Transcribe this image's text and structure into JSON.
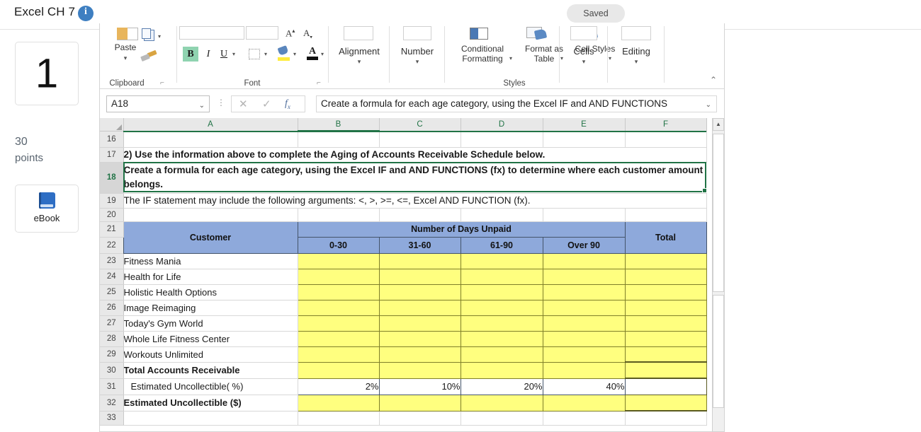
{
  "topbar": {
    "title": "Excel CH 7",
    "info_icon": "info-icon",
    "saved_label": "Saved"
  },
  "rail": {
    "question_number": "1",
    "points_value": "30",
    "points_label": "points",
    "ebook_label": "eBook",
    "ebook_icon": "book-icon"
  },
  "ribbon": {
    "groups": [
      {
        "label": "Clipboard"
      },
      {
        "label": "Font"
      },
      {
        "label": "Styles"
      }
    ],
    "paste_label": "Paste",
    "bold_label": "B",
    "italic_label": "I",
    "underline_label": "U",
    "increase_font_label": "A",
    "decrease_font_label": "A",
    "alignment_label": "Alignment",
    "number_label": "Number",
    "conditional_formatting_label": "Conditional Formatting",
    "format_as_table_label": "Format as Table",
    "cell_styles_label": "Cell Styles",
    "cells_label": "Cells",
    "editing_label": "Editing"
  },
  "formula_bar": {
    "name_box_value": "A18",
    "cancel_icon": "close-icon",
    "enter_icon": "check-icon",
    "function_icon": "fx-icon",
    "formula_value": "Create a formula for each age category, using the Excel IF and AND FUNCTIONS"
  },
  "grid": {
    "column_headers": [
      "A",
      "B",
      "C",
      "D",
      "E",
      "F"
    ],
    "selected_column": "B",
    "selected_row": "18",
    "row_numbers": [
      "16",
      "17",
      "18",
      "19",
      "20",
      "21",
      "22",
      "23",
      "24",
      "25",
      "26",
      "27",
      "28",
      "29",
      "30",
      "31",
      "32",
      "33"
    ],
    "r17_a": "2) Use the information above to complete the Aging of Accounts Receivable Schedule below.",
    "r18_a": "Create a formula for each age category, using the Excel IF and AND FUNCTIONS (fx) to determine where each customer amount belongs.",
    "r19_a": "The IF statement may include the following arguments:  <, >, >=, <=, Excel AND FUNCTION (fx).",
    "r21_days_header": "Number of Days Unpaid",
    "r22_headers": [
      "Customer",
      "0-30",
      "31-60",
      "61-90",
      "Over 90",
      "Total"
    ],
    "customer_rows": [
      {
        "row": "23",
        "name": "Fitness Mania"
      },
      {
        "row": "24",
        "name": "Health for Life"
      },
      {
        "row": "25",
        "name": "Holistic Health Options"
      },
      {
        "row": "26",
        "name": "Image Reimaging"
      },
      {
        "row": "27",
        "name": "Today's Gym World"
      },
      {
        "row": "28",
        "name": "Whole Life Fitness Center"
      },
      {
        "row": "29",
        "name": "Workouts Unlimited"
      }
    ],
    "r30_label": "Total Accounts Receivable",
    "r31_label": "   Estimated Uncollectible( %)",
    "r31_values": [
      "2%",
      "10%",
      "20%",
      "40%"
    ],
    "r32_label": "Estimated Uncollectible ($)"
  },
  "scrollbar": {
    "up_arrow": "scroll-up-icon"
  },
  "colors": {
    "header_blue": "#8ea9db",
    "input_yellow": "#ffff7f",
    "excel_green": "#217346",
    "brand_blue": "#3e7fc1"
  }
}
